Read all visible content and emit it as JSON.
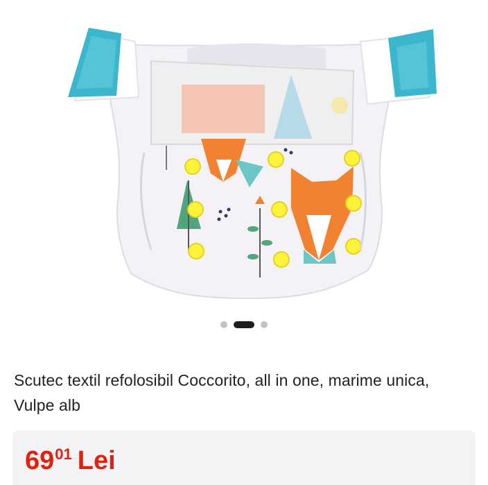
{
  "product": {
    "image_alt": "Scutec textil refolosibil Coccorito",
    "gallery": {
      "total_images": 3,
      "active_index": 1
    },
    "title": "Scutec textil refolosibil Coccorito, all in one, marime unica, Vulpe alb",
    "price": {
      "integer": "69",
      "decimal": "01",
      "currency": "Lei"
    }
  },
  "colors": {
    "price": "#e3200f",
    "velcro_tab": "#3cb6cc",
    "fox_orange": "#f08232",
    "snap_yellow": "#fff23a"
  },
  "icons": {
    "dot_inactive": "dot-icon",
    "dot_active": "dot-active-icon"
  }
}
